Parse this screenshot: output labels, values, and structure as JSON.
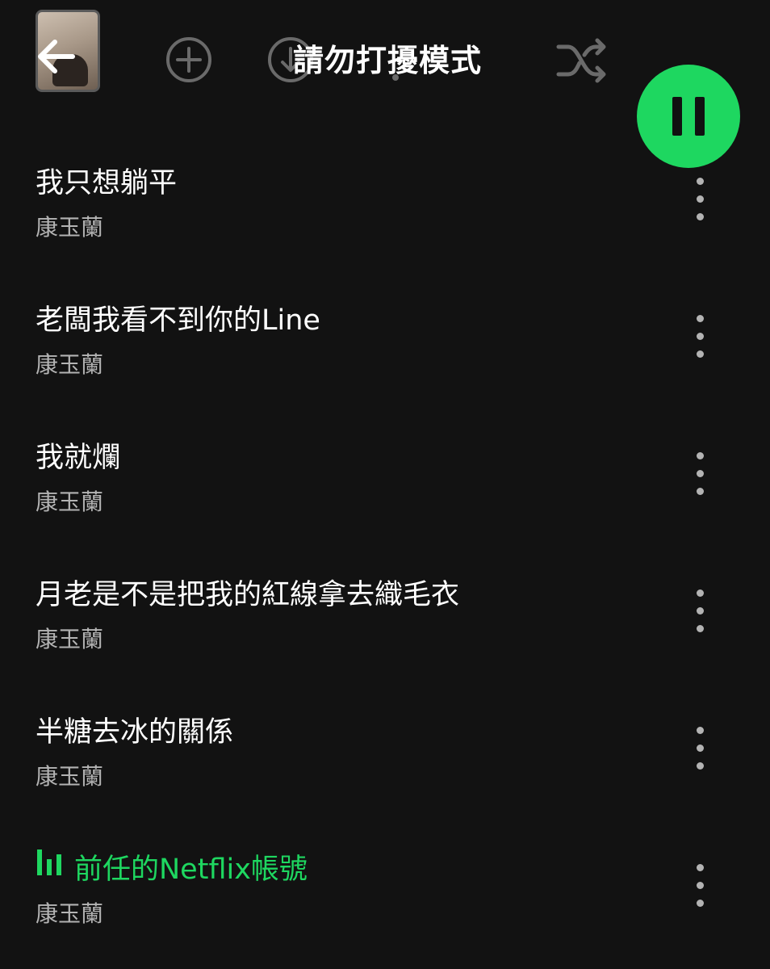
{
  "header": {
    "title": "請勿打擾模式",
    "icons": [
      "back-arrow-icon",
      "plus-circle-icon",
      "download-circle-icon",
      "more-icon",
      "shuffle-icon"
    ]
  },
  "player": {
    "state": "playing",
    "button_icon": "pause-icon",
    "accent_color": "#1ed760"
  },
  "tracks": [
    {
      "title": "我只想躺平",
      "artist": "康玉蘭",
      "playing": false
    },
    {
      "title": "老闆我看不到你的Line",
      "artist": "康玉蘭",
      "playing": false
    },
    {
      "title": "我就爛",
      "artist": "康玉蘭",
      "playing": false
    },
    {
      "title": "月老是不是把我的紅線拿去織毛衣",
      "artist": "康玉蘭",
      "playing": false
    },
    {
      "title": "半糖去冰的關係",
      "artist": "康玉蘭",
      "playing": false
    },
    {
      "title": "前任的Netflix帳號",
      "artist": "康玉蘭",
      "playing": true
    }
  ]
}
